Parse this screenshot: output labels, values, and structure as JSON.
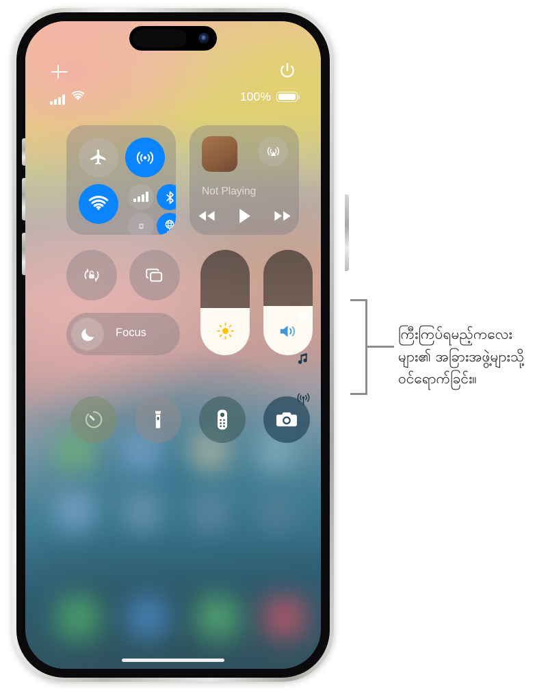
{
  "device": {
    "name": "iPhone",
    "frame_color": "#d9d8d3"
  },
  "status_bar": {
    "cellular_icon": "cellular-bars-icon",
    "wifi_icon": "wifi-icon",
    "battery_percent": "100%",
    "battery_icon": "battery-full-icon"
  },
  "control_center": {
    "add_controls_icon": "plus-icon",
    "power_icon": "power-icon",
    "connectivity": {
      "title": "Connectivity",
      "toggles": [
        {
          "name": "airplane-mode",
          "icon": "airplane-icon",
          "state": "off",
          "color": "#bebec3"
        },
        {
          "name": "airdrop",
          "icon": "airdrop-icon",
          "state": "on",
          "color": "#0a84ff"
        },
        {
          "name": "wifi",
          "icon": "wifi-icon",
          "state": "on",
          "color": "#0a84ff"
        },
        {
          "name": "cellular-data",
          "icon": "cellular-bars-icon",
          "state": "off",
          "color": "#bebec3"
        },
        {
          "name": "bluetooth",
          "icon": "bluetooth-icon",
          "state": "on",
          "color": "#0a84ff"
        },
        {
          "name": "shareplay",
          "icon": "shareplay-icon",
          "state": "off",
          "color": "#bebec3"
        },
        {
          "name": "vpn",
          "icon": "vpn-globe-icon",
          "state": "on",
          "color": "#0a84ff"
        }
      ]
    },
    "media": {
      "now_playing_title": "Not Playing",
      "airplay_icon": "airplay-audio-icon",
      "album_art": "album-art-placeholder",
      "controls": [
        {
          "name": "rewind-button",
          "icon": "rewind-icon"
        },
        {
          "name": "play-button",
          "icon": "play-icon"
        },
        {
          "name": "fast-forward-button",
          "icon": "fast-forward-icon"
        }
      ]
    },
    "rotation_lock": {
      "label": "Rotation Lock",
      "icon": "rotation-lock-icon",
      "state": "off"
    },
    "screen_mirroring": {
      "label": "Screen Mirroring",
      "icon": "screen-mirroring-icon",
      "state": "off"
    },
    "focus": {
      "label": "Focus",
      "icon": "moon-icon",
      "state": "off"
    },
    "sliders": [
      {
        "name": "brightness-slider",
        "icon": "sun-icon",
        "value": 45,
        "icon_color": "#ffc107"
      },
      {
        "name": "volume-slider",
        "icon": "speaker-wave-icon",
        "value": 47,
        "icon_color": "#3d9ad6"
      }
    ],
    "quick_actions": [
      {
        "name": "timer",
        "label": "Timer",
        "icon": "timer-icon",
        "tint": "#7e8e6e"
      },
      {
        "name": "flashlight",
        "label": "Flashlight",
        "icon": "flashlight-icon",
        "tint": "#968c8c"
      },
      {
        "name": "apple-tv-remote",
        "label": "Apple TV Remote",
        "icon": "tv-remote-icon",
        "tint": "#3e5c5e"
      },
      {
        "name": "camera",
        "label": "Camera",
        "icon": "camera-icon",
        "tint": "#24465c"
      }
    ],
    "page_indicators": [
      {
        "name": "favorites-page",
        "icon": "heart-icon",
        "active": true
      },
      {
        "name": "media-page",
        "icon": "music-note-icon",
        "active": false
      },
      {
        "name": "connectivity-page",
        "icon": "broadcast-icon",
        "active": false
      }
    ]
  },
  "callout": {
    "text": "ကြီးကြပ်ရမည့်ကလေးများ၏ အခြားအဖွဲ့များသို့ ဝင်ရောက်ခြင်း။",
    "line_color": "#8c8c8c"
  }
}
